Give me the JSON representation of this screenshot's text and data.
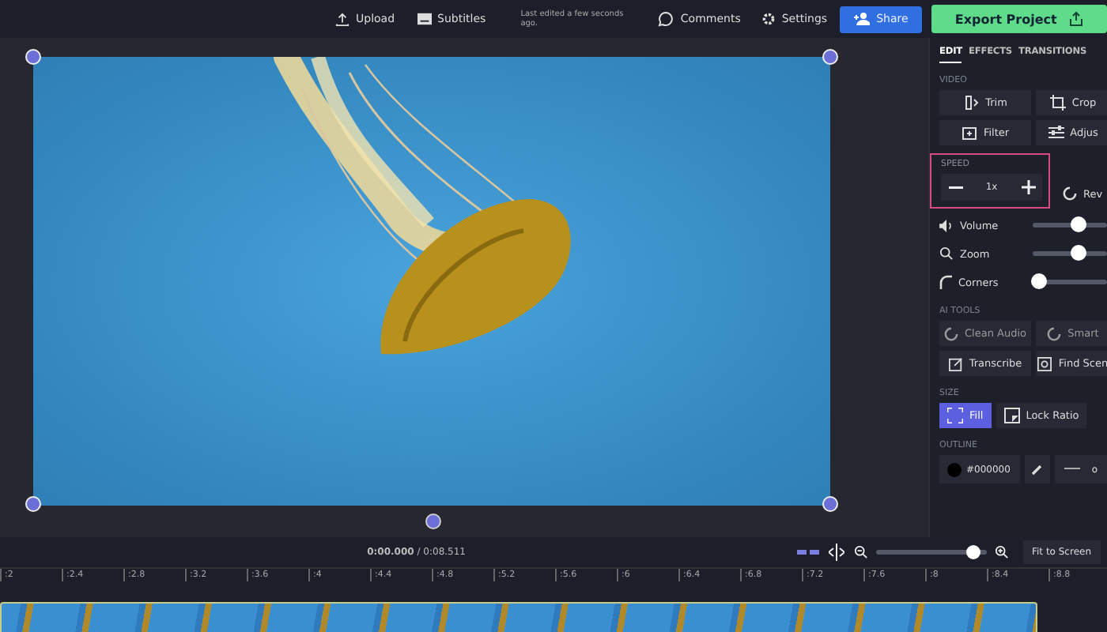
{
  "top_bar": {
    "upload": "Upload",
    "subtitles": "Subtitles",
    "last_edited": "Last edited a few seconds ago.",
    "comments": "Comments",
    "settings": "Settings",
    "share": "Share",
    "export": "Export Project"
  },
  "panel": {
    "tabs": [
      {
        "label": "EDIT",
        "selected": true
      },
      {
        "label": "EFFECTS",
        "selected": false
      },
      {
        "label": "TRANSITIONS",
        "selected": false
      }
    ],
    "video_heading": "VIDEO",
    "video_buttons": [
      {
        "label": "Trim"
      },
      {
        "label": "Crop"
      },
      {
        "label": "Filter"
      },
      {
        "label": "Adjus"
      }
    ],
    "speed": {
      "heading": "SPEED",
      "value": "1x",
      "highlighted": true,
      "reverse": "Rev"
    },
    "sliders": [
      {
        "label": "Volume",
        "level": 0.62
      },
      {
        "label": "Zoom",
        "level": 0.62
      },
      {
        "label": "Corners",
        "level": 0.1
      }
    ],
    "ai_heading": "AI TOOLS",
    "ai_buttons": [
      {
        "label": "Clean Audio",
        "disabled": true
      },
      {
        "label": "Smart",
        "disabled": true
      },
      {
        "label": "Transcribe",
        "disabled": false
      },
      {
        "label": "Find Scen",
        "disabled": false
      }
    ],
    "size_heading": "SIZE",
    "size_buttons": [
      {
        "label": "Fill",
        "selected": true
      },
      {
        "label": "Lock Ratio",
        "selected": false
      }
    ],
    "outline_heading": "OUTLINE",
    "outline": {
      "color_value": "#000000",
      "width": "o"
    }
  },
  "timeline": {
    "time": "**0:00.000** / 0:08.511",
    "zoom_slider": {
      "level": 0.88
    },
    "fit": "Fit to Screen",
    "ticks": [
      ":2",
      ":2.4",
      ":2.8",
      ":3.2",
      ":3.6",
      ":4",
      ":4.4",
      ":4.8",
      ":5.2",
      ":5.6",
      ":6",
      ":6.4",
      ":6.8",
      ":7.2",
      ":7.6",
      ":8",
      ":8.4",
      ":8.8"
    ]
  }
}
